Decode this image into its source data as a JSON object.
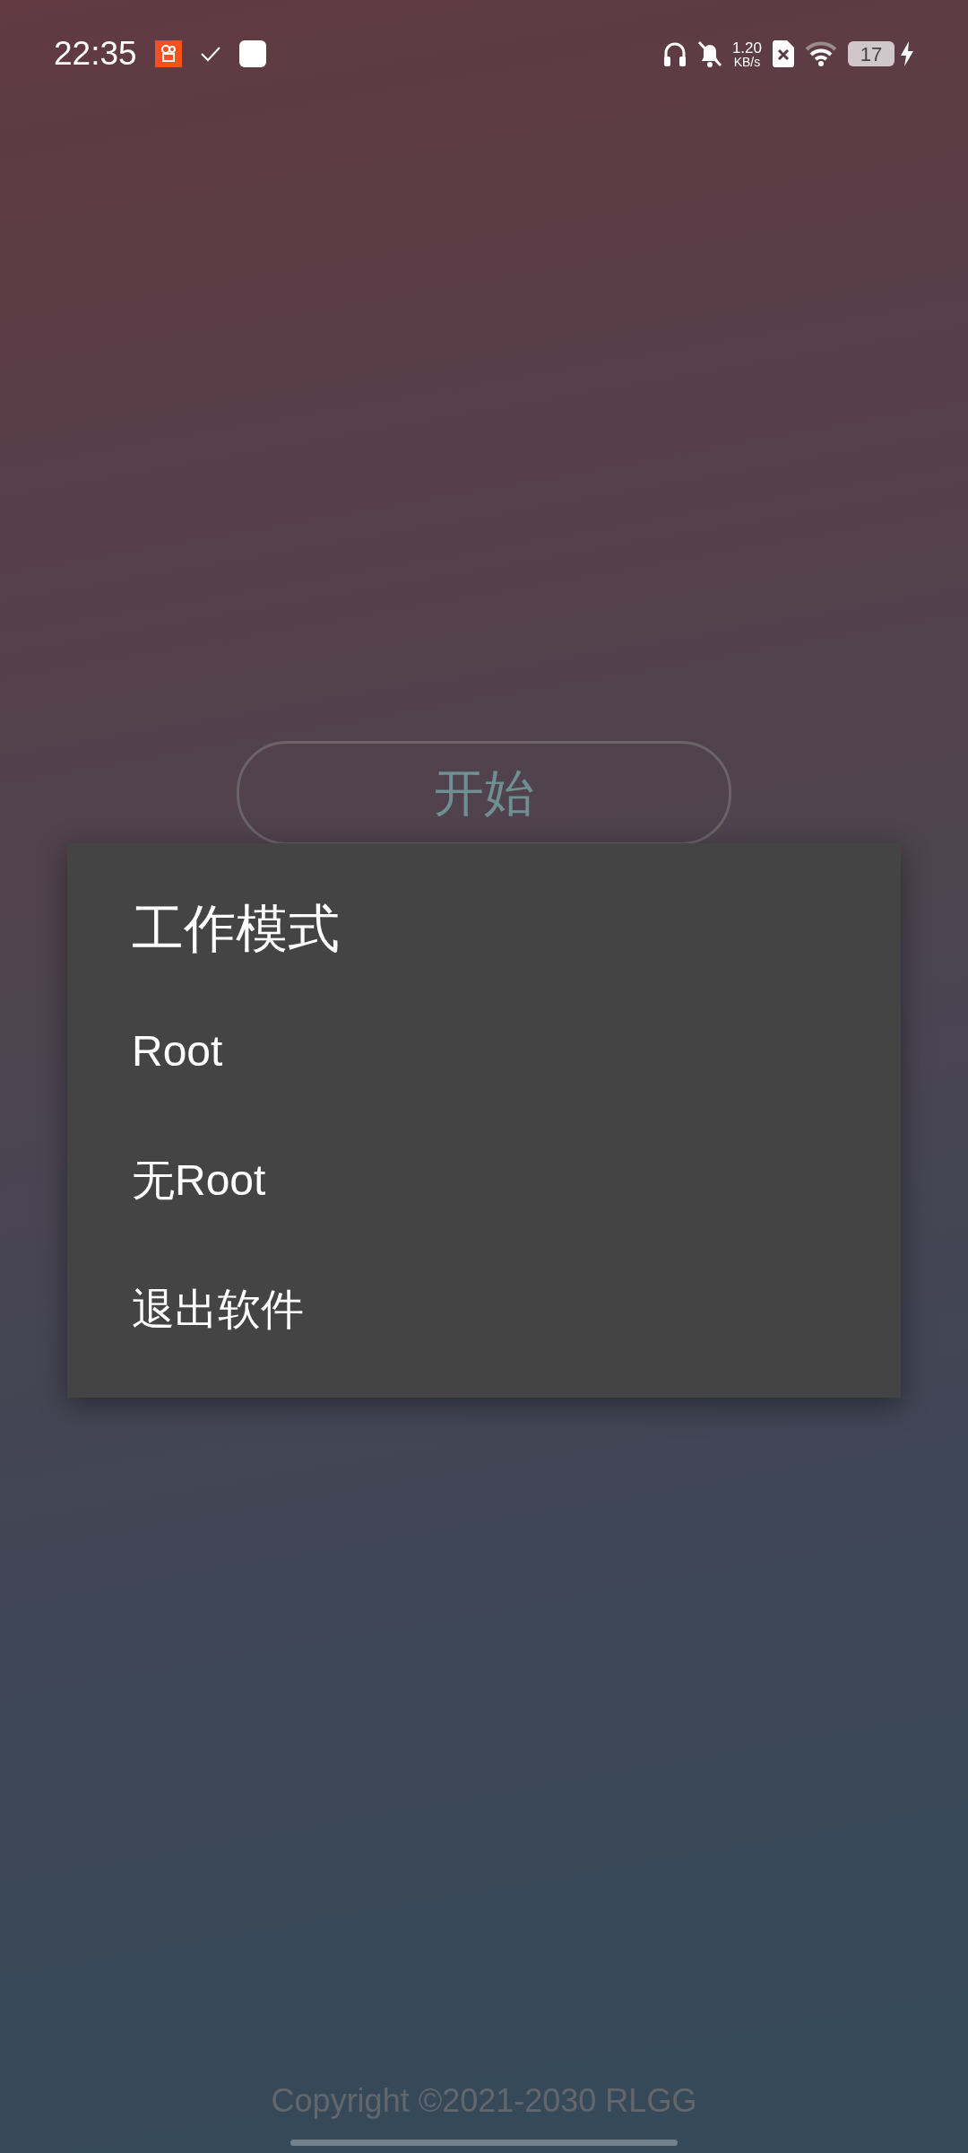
{
  "status_bar": {
    "time": "22:35",
    "net_speed": "1.20",
    "net_unit": "KB/s",
    "battery": "17"
  },
  "start_button": {
    "label": "开始"
  },
  "dialog": {
    "title": "工作模式",
    "items": [
      {
        "label": "Root"
      },
      {
        "label": "无Root"
      },
      {
        "label": "退出软件"
      }
    ]
  },
  "footer": {
    "copyright": "Copyright ©2021-2030 RLGG"
  }
}
